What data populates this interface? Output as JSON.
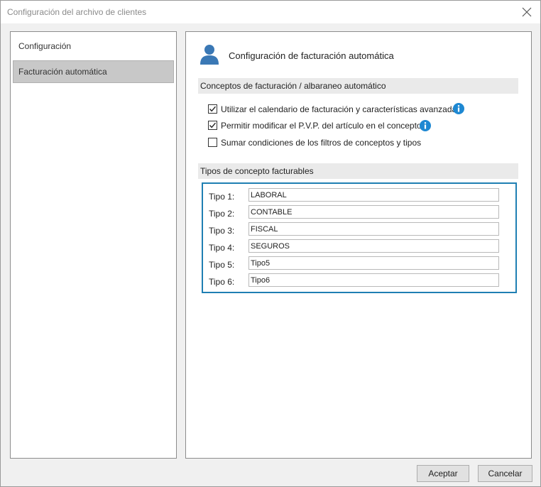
{
  "window": {
    "title": "Configuración del archivo de clientes"
  },
  "sidebar": {
    "items": [
      {
        "label": "Configuración",
        "selected": false
      },
      {
        "label": "Facturación automática",
        "selected": true
      }
    ]
  },
  "main": {
    "title": "Configuración de facturación automática",
    "icon": "user-icon",
    "section1": {
      "title": "Conceptos de facturación / albaraneo automático",
      "options": [
        {
          "label": "Utilizar el calendario de facturación y características avanzadas",
          "checked": true,
          "info": true
        },
        {
          "label": "Permitir modificar el P.V.P. del artículo en el concepto",
          "checked": true,
          "info": true
        },
        {
          "label": "Sumar condiciones de los filtros de conceptos y tipos",
          "checked": false,
          "info": false
        }
      ]
    },
    "section2": {
      "title": "Tipos de concepto facturables",
      "types": [
        {
          "label": "Tipo 1:",
          "value": "LABORAL"
        },
        {
          "label": "Tipo 2:",
          "value": "CONTABLE"
        },
        {
          "label": "Tipo 3:",
          "value": "FISCAL"
        },
        {
          "label": "Tipo 4:",
          "value": "SEGUROS"
        },
        {
          "label": "Tipo 5:",
          "value": "Tipo5"
        },
        {
          "label": "Tipo 6:",
          "value": "Tipo6"
        }
      ]
    }
  },
  "buttons": {
    "accept": "Aceptar",
    "cancel": "Cancelar"
  },
  "colors": {
    "accent": "#1f7fb3",
    "info": "#1e88d2",
    "user_icon": "#3a78b5"
  }
}
